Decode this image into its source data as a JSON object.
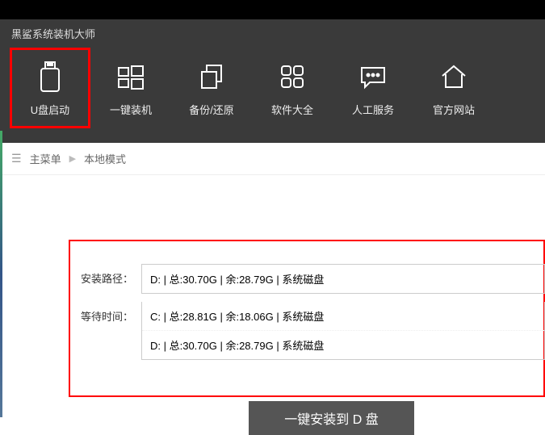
{
  "app": {
    "title": "黑鲨系统装机大师"
  },
  "nav": [
    {
      "label": "U盘启动"
    },
    {
      "label": "一键装机"
    },
    {
      "label": "备份/还原"
    },
    {
      "label": "软件大全"
    },
    {
      "label": "人工服务"
    },
    {
      "label": "官方网站"
    }
  ],
  "breadcrumb": {
    "main": "主菜单",
    "current": "本地模式"
  },
  "form": {
    "path_label": "安装路径：",
    "path_value": "D: | 总:30.70G | 余:28.79G | 系统磁盘",
    "wait_label": "等待时间：",
    "options": [
      "C: | 总:28.81G | 余:18.06G | 系统磁盘",
      "D: | 总:30.70G | 余:28.79G | 系统磁盘"
    ]
  },
  "action": {
    "install_label": "一键安装到 D 盘"
  }
}
